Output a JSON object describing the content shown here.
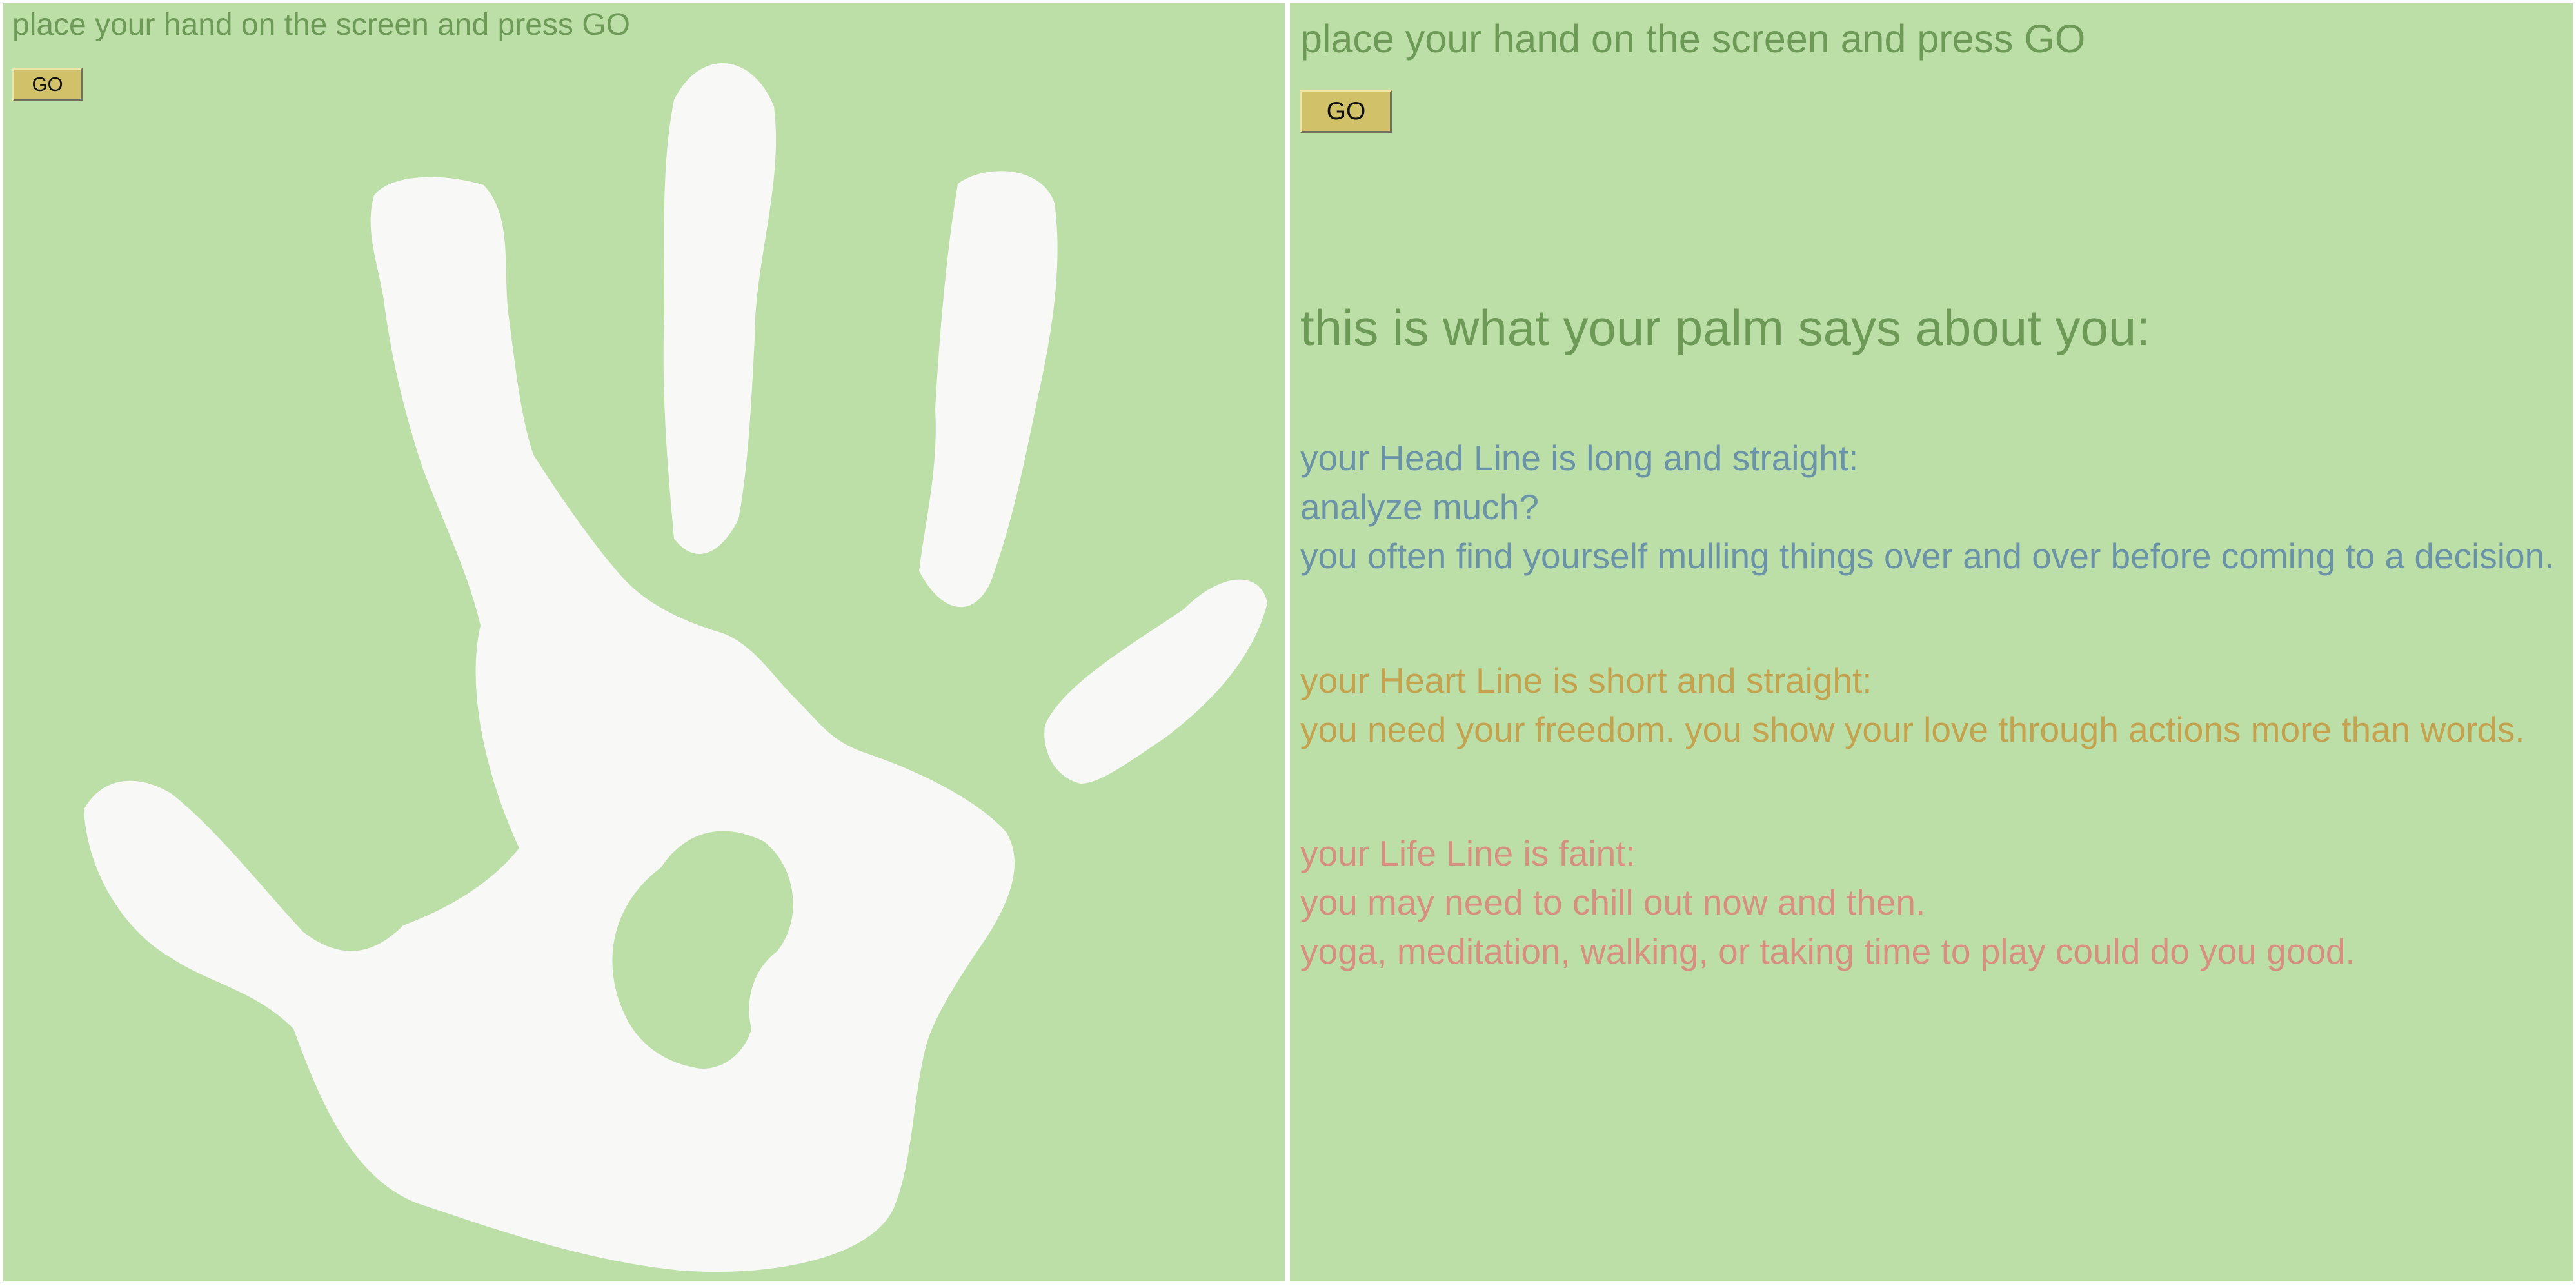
{
  "left_panel": {
    "instruction": "place your hand on the screen and press GO",
    "go_button": "GO"
  },
  "right_panel": {
    "instruction": "place your hand on the screen and press GO",
    "go_button": "GO",
    "heading": "this is what your palm says about you:",
    "head_line": {
      "lines": [
        "your Head Line is long and straight:",
        "analyze much?",
        "you often find yourself mulling things over and over before coming to a decision."
      ]
    },
    "heart_line": {
      "lines": [
        "your Heart Line is short and straight:",
        "you need your freedom. you show your love through actions more than words."
      ]
    },
    "life_line": {
      "lines": [
        "your Life Line is faint:",
        "you may need to chill out now and then.",
        "yoga, meditation, walking, or taking time to play could do you good."
      ]
    }
  },
  "colors": {
    "screen_background": "#bcdea7",
    "instruction_text": "#6d9a57",
    "hand_print": "#f8f8f7",
    "button": "#d1c26a",
    "head_line_text": "#6a93a8",
    "heart_line_text": "#c4a24e",
    "life_line_text": "#d78f80"
  },
  "icons": {
    "hand": "handprint-icon"
  }
}
